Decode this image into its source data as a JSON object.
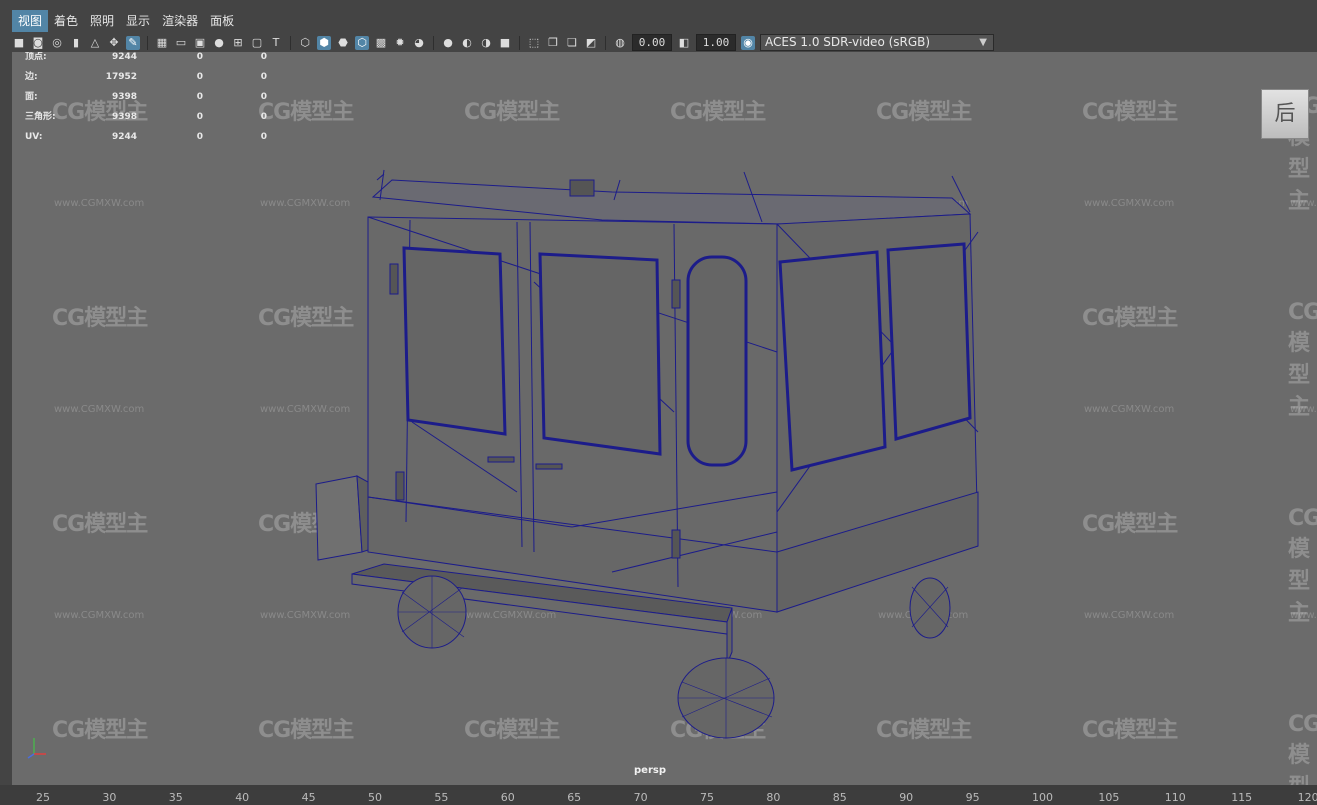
{
  "menu": {
    "items": [
      "视图",
      "着色",
      "照明",
      "显示",
      "渲染器",
      "面板"
    ]
  },
  "toolbar": {
    "exposure": "0.00",
    "gamma": "1.00",
    "color_space": "ACES 1.0 SDR-video (sRGB)"
  },
  "hud": {
    "rows": [
      {
        "label": "顶点:",
        "v1": "9244",
        "v2": "0",
        "v3": "0"
      },
      {
        "label": "边:",
        "v1": "17952",
        "v2": "0",
        "v3": "0"
      },
      {
        "label": "面:",
        "v1": "9398",
        "v2": "0",
        "v3": "0"
      },
      {
        "label": "三角形:",
        "v1": "9398",
        "v2": "0",
        "v3": "0"
      },
      {
        "label": "UV:",
        "v1": "9244",
        "v2": "0",
        "v3": "0"
      }
    ]
  },
  "viewcube": {
    "label": "后"
  },
  "viewport": {
    "camera": "persp"
  },
  "watermark": {
    "logo": "CG模型主",
    "url": "www.CGMXW.com"
  },
  "timeline": {
    "ticks": [
      "25",
      "30",
      "35",
      "40",
      "45",
      "50",
      "55",
      "60",
      "65",
      "70",
      "75",
      "80",
      "85",
      "90",
      "95",
      "100",
      "105",
      "110",
      "115",
      "120"
    ]
  },
  "colors": {
    "accent": "#5285a6",
    "wireframe": "#1a1a8c",
    "viewport_bg": "#6b6b6b"
  }
}
